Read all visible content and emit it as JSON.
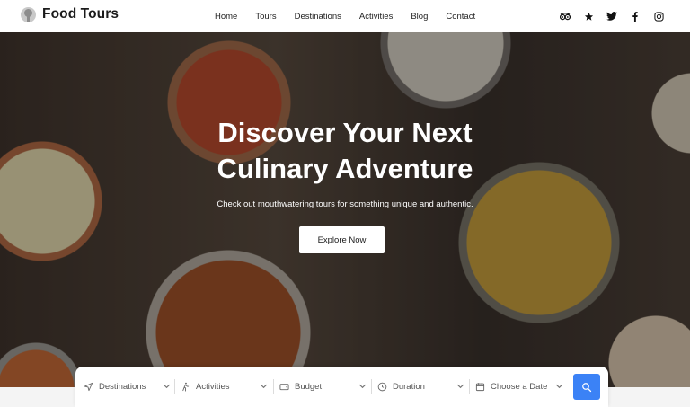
{
  "brand": {
    "name": "Food Tours",
    "logo_icon": "globe-logo-icon"
  },
  "nav": {
    "items": [
      "Home",
      "Tours",
      "Destinations",
      "Activities",
      "Blog",
      "Contact"
    ]
  },
  "social": [
    "tripadvisor-icon",
    "star-icon",
    "twitter-icon",
    "facebook-icon",
    "instagram-icon"
  ],
  "hero": {
    "title_line1": "Discover Your Next",
    "title_line2": "Culinary Adventure",
    "subtitle": "Check out mouthwatering tours for something unique and authentic.",
    "cta": "Explore Now"
  },
  "search": {
    "fields": [
      {
        "label": "Destinations",
        "icon": "navigation-arrow-icon"
      },
      {
        "label": "Activities",
        "icon": "walking-person-icon"
      },
      {
        "label": "Budget",
        "icon": "wallet-icon"
      },
      {
        "label": "Duration",
        "icon": "clock-icon"
      },
      {
        "label": "Choose a Date",
        "icon": "calendar-icon"
      }
    ],
    "button_icon": "search-icon",
    "accent": "#3b82f6"
  }
}
